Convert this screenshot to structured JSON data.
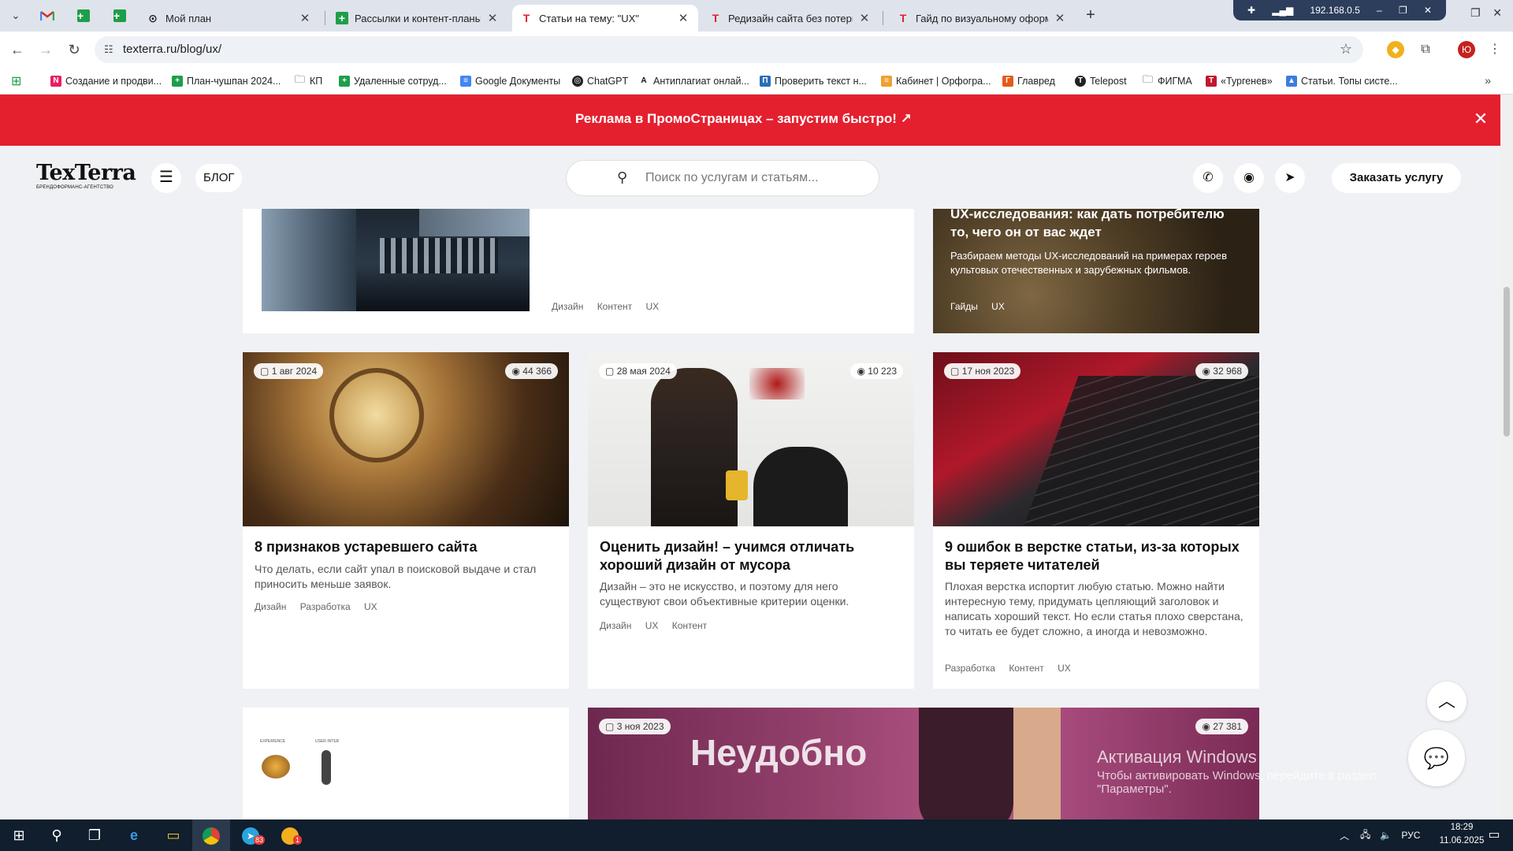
{
  "browser": {
    "tabs": [
      {
        "title": "Мой план",
        "favicon": "link-icon"
      },
      {
        "title": "Рассылки и контент-планы | Ма",
        "favicon": "sheets-icon"
      },
      {
        "title": "Статьи на тему: \"UX\"",
        "favicon": "texterra-icon",
        "active": true
      },
      {
        "title": "Редизайн сайта без потерь: ка",
        "favicon": "texterra-icon"
      },
      {
        "title": "Гайд по визуальному оформле",
        "favicon": "texterra-icon"
      }
    ],
    "new_tab": "+",
    "ip": "192.168.0.5",
    "url": "texterra.ru/blog/ux/",
    "profile_initial": "Ю"
  },
  "bookmarks": [
    {
      "label": "Создание и продви...",
      "color": "#e91e63",
      "glyph": "N"
    },
    {
      "label": "План-чушпан 2024...",
      "color": "#1e9e4a",
      "glyph": "+"
    },
    {
      "label": "КП",
      "color": "",
      "glyph": "folder"
    },
    {
      "label": "Удаленные сотруд...",
      "color": "#1e9e4a",
      "glyph": "+"
    },
    {
      "label": "Google Документы",
      "color": "#4285f4",
      "glyph": "≡"
    },
    {
      "label": "ChatGPT",
      "color": "#222",
      "glyph": "◎"
    },
    {
      "label": "Антиплагиат онлай...",
      "color": "#111",
      "glyph": "A"
    },
    {
      "label": "Проверить текст н...",
      "color": "#2a6fb5",
      "glyph": "П"
    },
    {
      "label": "Кабинет | Орфогра...",
      "color": "#f0a030",
      "glyph": "≡"
    },
    {
      "label": "Главред",
      "color": "#e25a1c",
      "glyph": "Г"
    },
    {
      "label": "Telepost",
      "color": "#222",
      "glyph": "T"
    },
    {
      "label": "ФИГМА",
      "color": "",
      "glyph": "folder"
    },
    {
      "label": "«Тургенев»",
      "color": "#c0182e",
      "glyph": "T"
    },
    {
      "label": "Статьи. Топы систе...",
      "color": "#3b7ddd",
      "glyph": "▲"
    }
  ],
  "promo": {
    "text": "Реклама в ПромоСтраницах – запустим быстро!",
    "arrow": "↗",
    "bg": "#e4202f"
  },
  "header": {
    "logo_main": "TexTerra",
    "logo_sub": "БРЕНДОФОРМАНС-АГЕНТСТВО",
    "blog": "БЛОГ",
    "search_placeholder": "Поиск по услугам и статьям...",
    "order": "Заказать услугу"
  },
  "cards": {
    "top_right": {
      "title": "UX-исследования: как дать потребителю то, чего он от вас ждет",
      "desc": "Разбираем методы UX-исследований на примерах героев культовых отечественных и зарубежных фильмов.",
      "tags": [
        "Гайды",
        "UX"
      ]
    },
    "top_mid_tags": [
      "Дизайн",
      "Контент",
      "UX"
    ],
    "row2": [
      {
        "date": "1 авг 2024",
        "views": "44 366",
        "title": "8 признаков устаревшего сайта",
        "desc": "Что делать, если сайт упал в поисковой выдаче и стал приносить меньше заявок.",
        "tags": [
          "Дизайн",
          "Разработка",
          "UX"
        ]
      },
      {
        "date": "28 мая 2024",
        "views": "10 223",
        "title": "Оценить дизайн! – учимся отличать хороший дизайн от мусора",
        "desc": "Дизайн – это не искусство, и поэтому для него существуют свои объективные критерии оценки.",
        "tags": [
          "Дизайн",
          "UX",
          "Контент"
        ]
      },
      {
        "date": "17 ноя 2023",
        "views": "32 968",
        "title": "9 ошибок в верстке статьи, из-за которых вы теряете читателей",
        "desc": "Плохая верстка испортит любую статью. Можно найти интересную тему, придумать цепляющий заголовок и написать хороший текст. Но если статья плохо сверстана, то читать ее будет сложно, а иногда и невозможно.",
        "tags": [
          "Разработка",
          "Контент",
          "UX"
        ]
      }
    ],
    "row3": {
      "date": "3 ноя 2023",
      "views": "27 381",
      "big_text": "Неудобно",
      "thumb_labels": [
        "EXPERIENCE",
        "USER INTER"
      ]
    }
  },
  "windows_activation": {
    "title": "Активация Windows",
    "text": "Чтобы активировать Windows, перейдите в раздел \"Параметры\"."
  },
  "taskbar": {
    "lang": "РУС",
    "time": "18:29",
    "date": "11.06.2025",
    "telegram_badge": "83",
    "app_badge": "1"
  }
}
